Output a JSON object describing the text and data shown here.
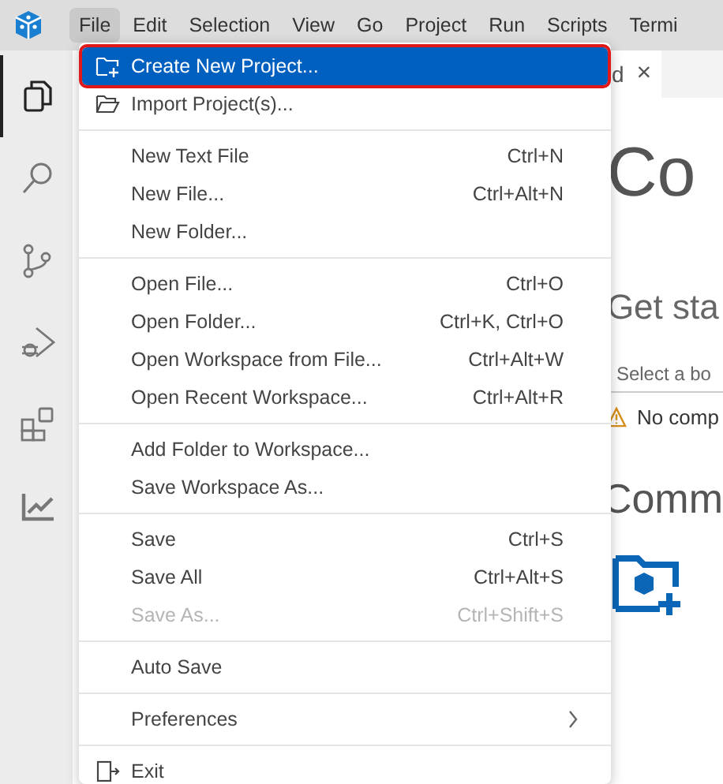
{
  "menubar": [
    {
      "label": "File",
      "selected": true
    },
    {
      "label": "Edit",
      "selected": false
    },
    {
      "label": "Selection",
      "selected": false
    },
    {
      "label": "View",
      "selected": false
    },
    {
      "label": "Go",
      "selected": false
    },
    {
      "label": "Project",
      "selected": false
    },
    {
      "label": "Run",
      "selected": false
    },
    {
      "label": "Scripts",
      "selected": false
    },
    {
      "label": "Termi",
      "selected": false
    }
  ],
  "activity_bar": [
    {
      "kind": "files",
      "selected": true
    },
    {
      "kind": "search",
      "selected": false
    },
    {
      "kind": "branch",
      "selected": false
    },
    {
      "kind": "debug",
      "selected": false
    },
    {
      "kind": "extensions",
      "selected": false
    },
    {
      "kind": "chart",
      "selected": false
    }
  ],
  "editor": {
    "tab": {
      "label": "d",
      "close": "×"
    },
    "title": "Co",
    "subtitle": "Get sta",
    "board_select": {
      "placeholder": "Select a bo"
    },
    "warning": "No comp",
    "section": "Comm"
  },
  "file_menu": [
    [
      {
        "label": "Create New Project...",
        "selected": true,
        "disabled": false
      },
      {
        "label": "Import Project(s)...",
        "selected": false,
        "disabled": false
      }
    ],
    [
      {
        "label": "New Text File",
        "shortcut": "Ctrl+N",
        "selected": false,
        "disabled": false
      },
      {
        "label": "New File...",
        "shortcut": "Ctrl+Alt+N",
        "selected": false,
        "disabled": false
      },
      {
        "label": "New Folder...",
        "selected": false,
        "disabled": false
      }
    ],
    [
      {
        "label": "Open File...",
        "shortcut": "Ctrl+O",
        "selected": false,
        "disabled": false
      },
      {
        "label": "Open Folder...",
        "shortcut": "Ctrl+K, Ctrl+O",
        "selected": false,
        "disabled": false
      },
      {
        "label": "Open Workspace from File...",
        "shortcut": "Ctrl+Alt+W",
        "selected": false,
        "disabled": false
      },
      {
        "label": "Open Recent Workspace...",
        "shortcut": "Ctrl+Alt+R",
        "selected": false,
        "disabled": false
      }
    ],
    [
      {
        "label": "Add Folder to Workspace...",
        "selected": false,
        "disabled": false
      },
      {
        "label": "Save Workspace As...",
        "selected": false,
        "disabled": false
      }
    ],
    [
      {
        "label": "Save",
        "shortcut": "Ctrl+S",
        "selected": false,
        "disabled": false
      },
      {
        "label": "Save All",
        "shortcut": "Ctrl+Alt+S",
        "selected": false,
        "disabled": false
      },
      {
        "label": "Save As...",
        "shortcut": "Ctrl+Shift+S",
        "selected": false,
        "disabled": true
      }
    ],
    [
      {
        "label": "Auto Save",
        "selected": false,
        "disabled": false
      }
    ],
    [
      {
        "label": "Preferences",
        "submenu": true,
        "selected": false,
        "disabled": false
      }
    ],
    [
      {
        "label": "Exit",
        "selected": false,
        "disabled": false
      }
    ]
  ]
}
